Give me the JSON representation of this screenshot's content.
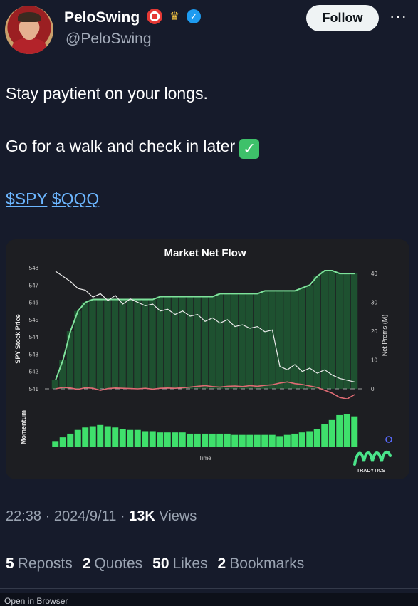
{
  "author": {
    "name": "PeloSwing",
    "handle": "@PeloSwing"
  },
  "follow_label": "Follow",
  "more_label": "···",
  "tweet": {
    "line1": "Stay paytient on your longs.",
    "line2": "Go for a walk and check in later",
    "check": "✓",
    "tag1": "$SPY",
    "tag2": "$QQQ"
  },
  "chart_data": {
    "type": "line",
    "title": "Market Net Flow",
    "xlabel": "Time",
    "ylabel_left": "SPY Stock Price",
    "ylabel_right": "Net Prems (M)",
    "momentum_label": "Momentum",
    "left_ticks": [
      "548",
      "547",
      "546",
      "545",
      "544",
      "543",
      "542",
      "541"
    ],
    "right_ticks": [
      "40",
      "30",
      "20",
      "10",
      "0"
    ],
    "ylim_left": [
      541,
      548
    ],
    "ylim_right": [
      -5,
      42
    ],
    "brand": "TRADYTICS",
    "spy_price": [
      547.8,
      547.5,
      547.2,
      546.8,
      546.7,
      546.3,
      546.5,
      546.1,
      546.4,
      545.9,
      546.2,
      546.0,
      545.8,
      545.9,
      545.5,
      545.6,
      545.3,
      545.5,
      545.2,
      545.3,
      544.9,
      545.1,
      544.8,
      545.0,
      544.6,
      544.7,
      544.5,
      544.6,
      544.3,
      544.4,
      542.3,
      542.1,
      542.4,
      542.0,
      542.2,
      541.9,
      542.1,
      541.8,
      541.6,
      541.5,
      541.4
    ],
    "net_call_prems": [
      3,
      10,
      20,
      27,
      30,
      31,
      31,
      31,
      31,
      31,
      31,
      31,
      31,
      31,
      32,
      32,
      32,
      32,
      32,
      32,
      32,
      32,
      33,
      33,
      33,
      33,
      33,
      33,
      34,
      34,
      34,
      34,
      34,
      35,
      36,
      39,
      41,
      41,
      40,
      40,
      40
    ],
    "net_put_prems": [
      0,
      0.5,
      0.3,
      -0.2,
      0.4,
      0.2,
      -0.5,
      0.1,
      0.3,
      0.2,
      0.1,
      0,
      0.2,
      -0.1,
      0.2,
      0.3,
      0.2,
      0.4,
      0.6,
      0.9,
      1.1,
      0.8,
      0.6,
      0.9,
      1.0,
      0.8,
      1.1,
      0.9,
      1.2,
      1.4,
      2.0,
      2.4,
      1.8,
      1.5,
      1.0,
      0.5,
      -0.5,
      -1.5,
      -3,
      -3.5,
      -2
    ],
    "momentum": [
      5,
      8,
      11,
      14,
      16,
      17,
      18,
      17,
      16,
      15,
      14,
      14,
      13,
      13,
      12,
      12,
      12,
      12,
      11,
      11,
      11,
      11,
      11,
      11,
      10,
      10,
      10,
      10,
      10,
      10,
      9,
      10,
      11,
      12,
      13,
      15,
      19,
      22,
      26,
      27,
      25
    ]
  },
  "timestamp": "22:38 · 2024/9/11 · ",
  "views_count": "13K",
  "views_label": "Views",
  "stats": [
    {
      "count": "5",
      "label": "Reposts"
    },
    {
      "count": "2",
      "label": "Quotes"
    },
    {
      "count": "50",
      "label": "Likes"
    },
    {
      "count": "2",
      "label": "Bookmarks"
    }
  ],
  "bottom_text": "Open in Browser"
}
